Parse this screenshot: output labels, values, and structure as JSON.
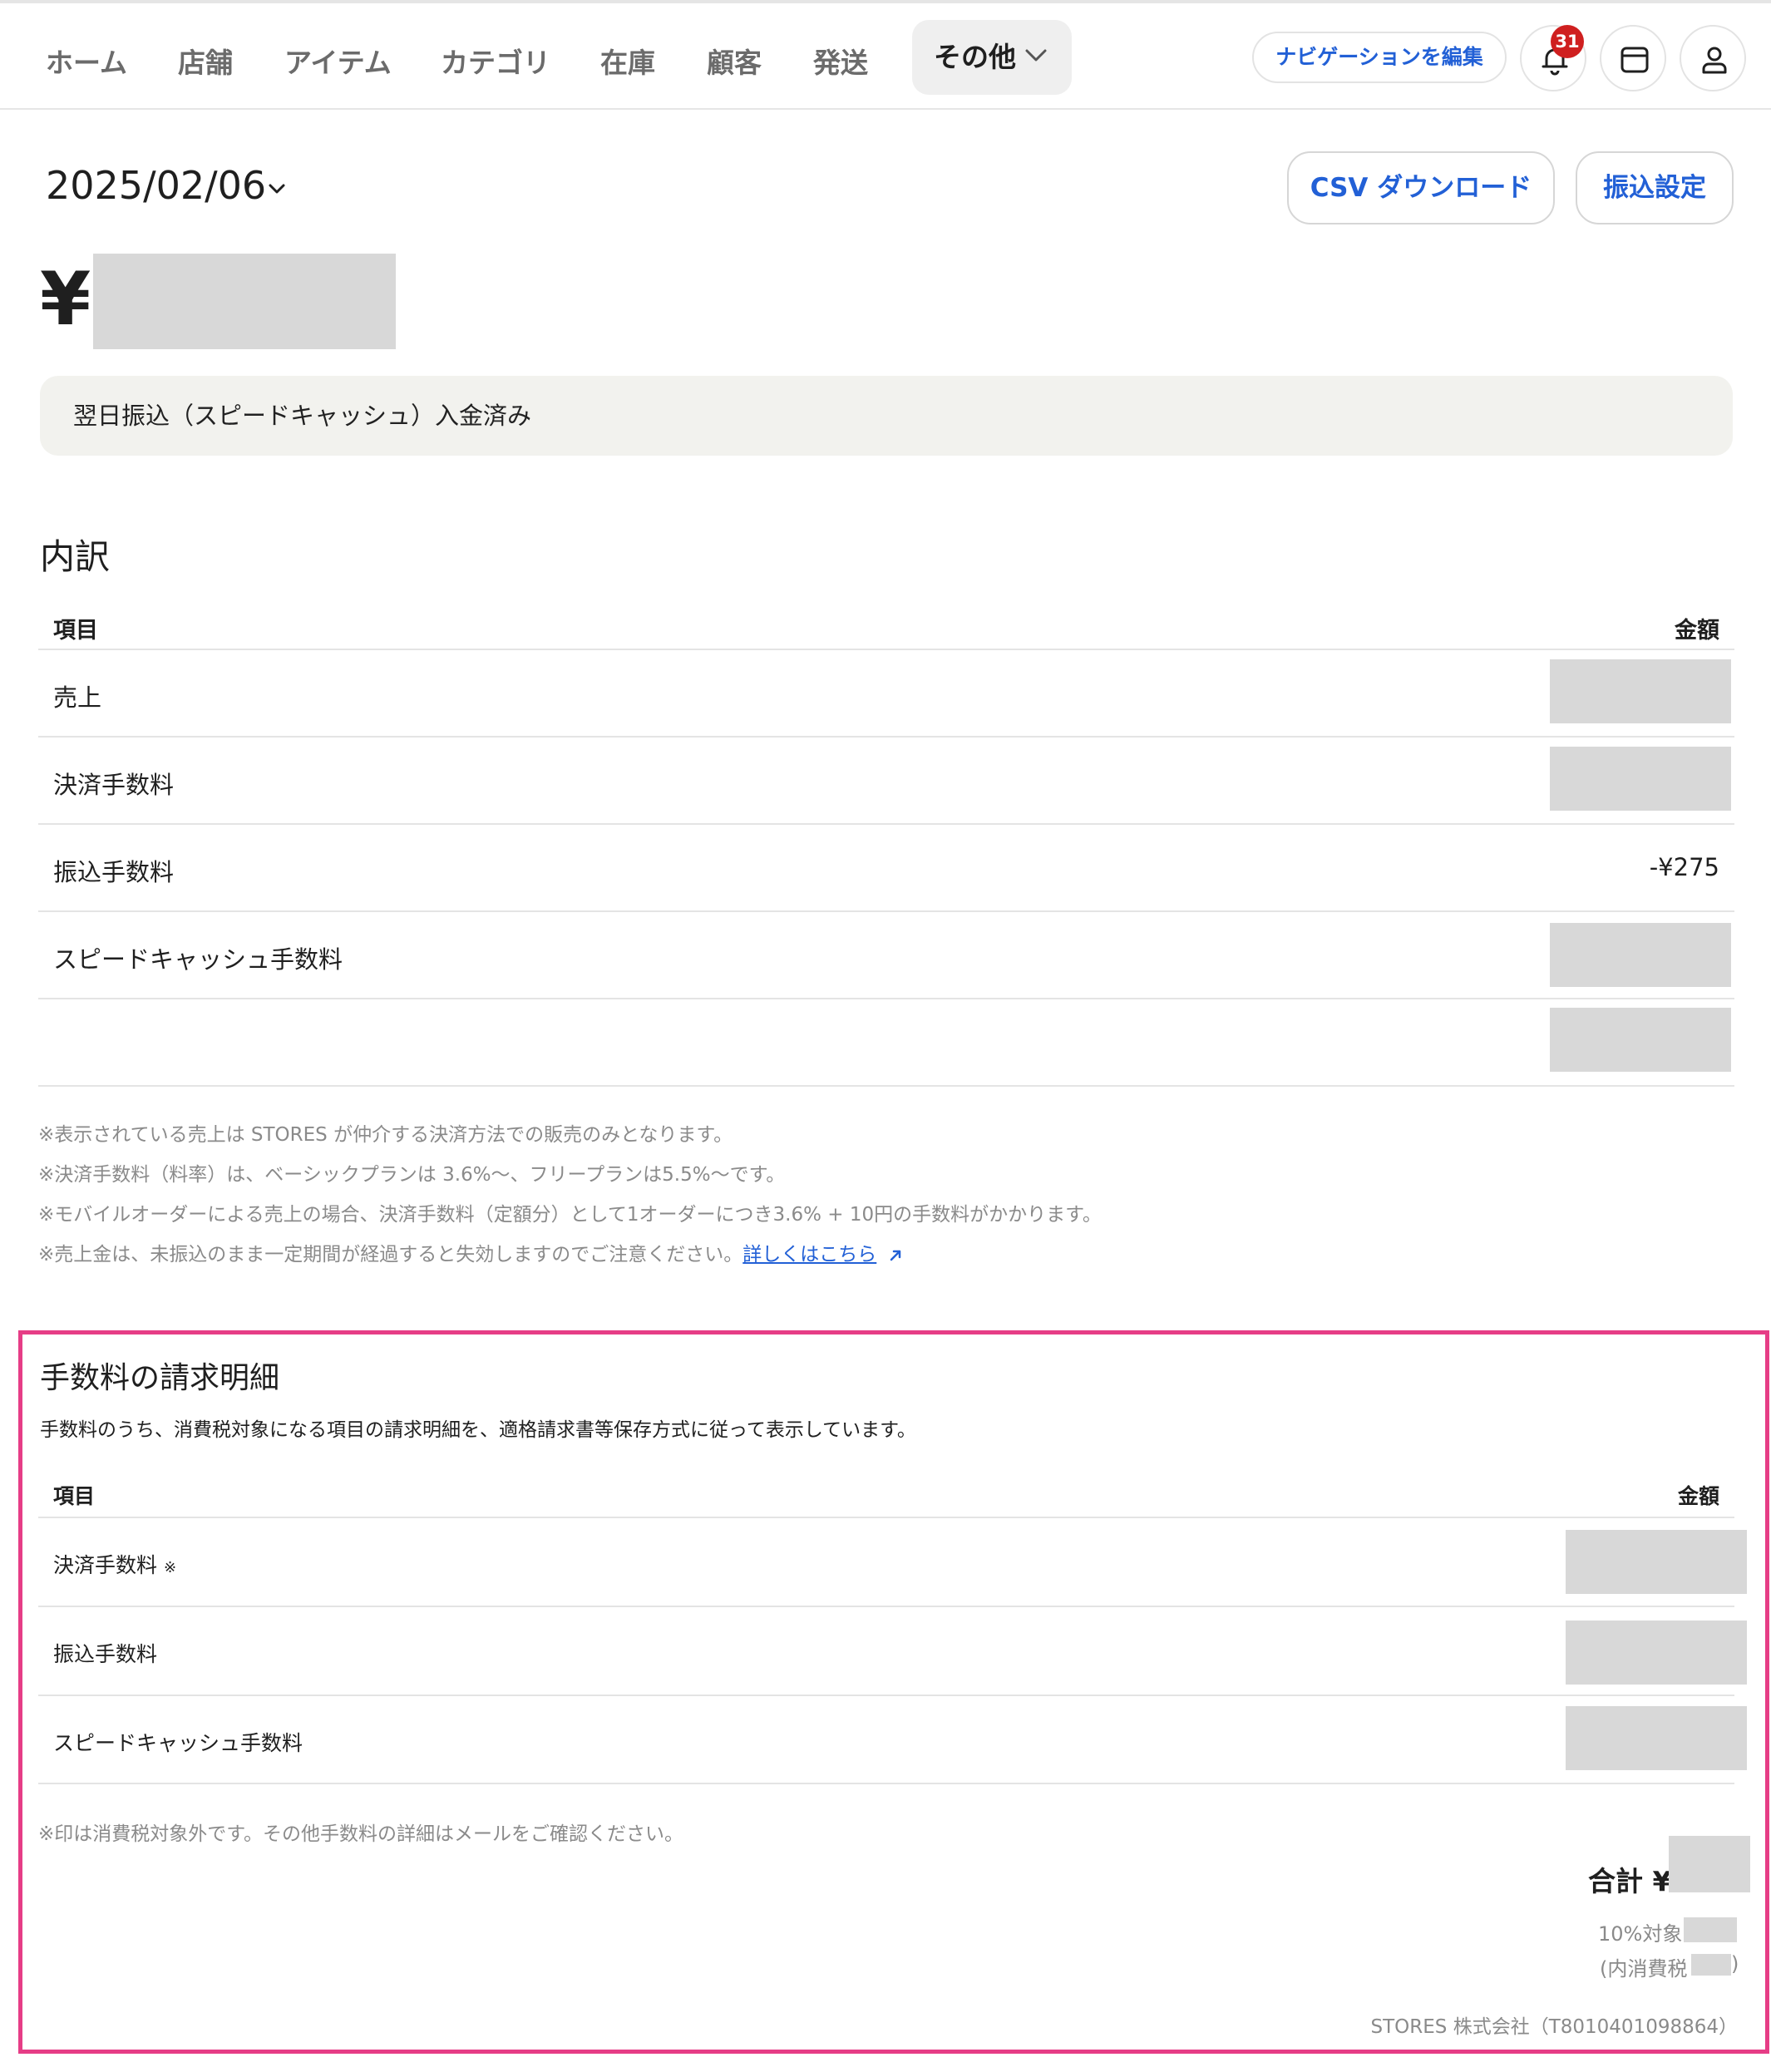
{
  "nav": {
    "items": [
      "ホーム",
      "店舗",
      "アイテム",
      "カテゴリ",
      "在庫",
      "顧客",
      "発送"
    ],
    "more_label": "その他",
    "edit_label": "ナビゲーションを編集",
    "notification_count": "31",
    "icons": [
      "bell-icon",
      "store-icon",
      "user-icon"
    ]
  },
  "header": {
    "date": "2025/02/06",
    "csv_button": "CSV ダウンロード",
    "transfer_settings_button": "振込設定",
    "amount_symbol": "¥"
  },
  "status": {
    "text": "翌日振込（スピードキャッシュ）入金済み"
  },
  "breakdown": {
    "title": "内訳",
    "col_item": "項目",
    "col_amount": "金額",
    "rows": [
      {
        "label": "売上",
        "amount": ""
      },
      {
        "label": "決済手数料",
        "amount": ""
      },
      {
        "label": "振込手数料",
        "amount": "-¥275"
      },
      {
        "label": "スピードキャッシュ手数料",
        "amount": ""
      },
      {
        "label": "",
        "amount": ""
      }
    ],
    "notes": [
      "※表示されている売上は STORES が仲介する決済方法での販売のみとなります。",
      "※決済手数料（料率）は、ベーシックプランは 3.6%〜、フリープランは5.5%〜です。",
      "※モバイルオーダーによる売上の場合、決済手数料（定額分）として1オーダーにつき3.6% + 10円の手数料がかかります。",
      "※売上金は、未振込のまま一定期間が経過すると失効しますのでご注意ください。"
    ],
    "details_link": "詳しくはこちら"
  },
  "invoice": {
    "title": "手数料の請求明細",
    "description": "手数料のうち、消費税対象になる項目の請求明細を、適格請求書等保存方式に従って表示しています。",
    "col_item": "項目",
    "col_amount": "金額",
    "rows": [
      {
        "label": "決済手数料",
        "mark": "※"
      },
      {
        "label": "振込手数料",
        "mark": ""
      },
      {
        "label": "スピードキャッシュ手数料",
        "mark": ""
      }
    ],
    "note": "※印は消費税対象外です。その他手数料の詳細はメールをご確認ください。",
    "total_label": "合計 ¥",
    "tax_target": "10%対象",
    "tax_included_open": "(内消費税",
    "tax_included_close": ")",
    "company": "STORES 株式会社（T8010401098864）"
  },
  "colors": {
    "accent_blue": "#2260d6",
    "highlight_frame": "#e63d86",
    "badge_red": "#cf1f1f"
  }
}
